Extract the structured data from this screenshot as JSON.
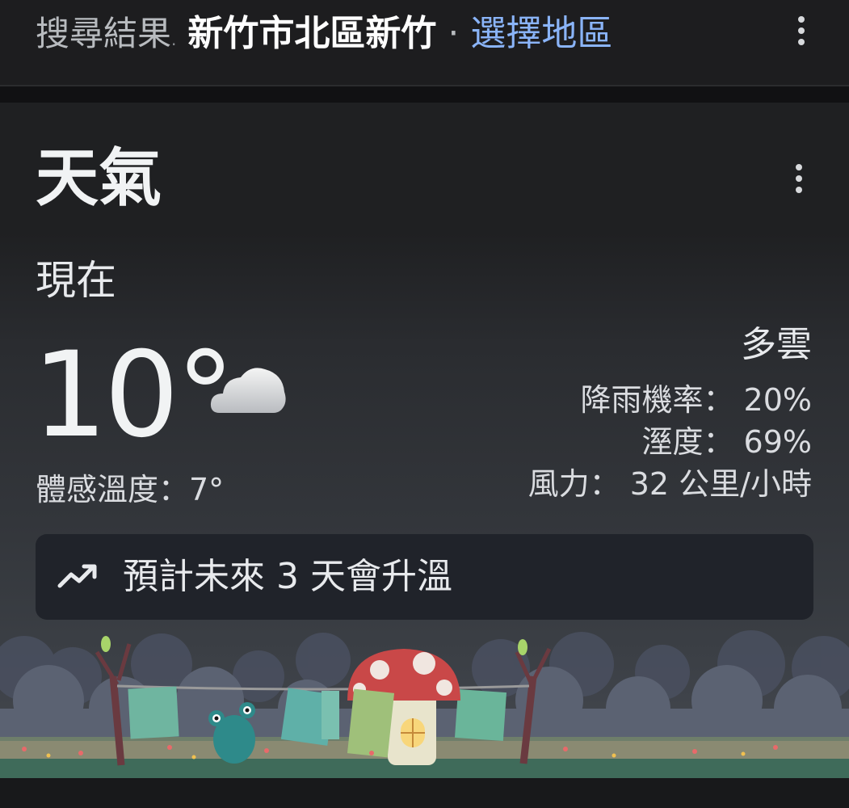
{
  "header": {
    "lead": "搜尋結果",
    "location": "新竹市北區新竹",
    "separator": "·",
    "choose_region": "選擇地區"
  },
  "card": {
    "title": "天氣",
    "now_label": "現在",
    "temperature": "10°",
    "weather_icon": "cloud-icon",
    "feels_like": "體感溫度：7°",
    "condition": "多雲",
    "precipitation": "降雨機率： 20%",
    "humidity": "溼度： 69%",
    "wind": "風力： 32 公里/小時",
    "trend_icon": "trending-up-icon",
    "trend_text": "預計未來 3 天會升溫"
  },
  "colors": {
    "accent_link": "#8ab4f8",
    "background": "#1f2022",
    "trend_box": "#20232a"
  }
}
